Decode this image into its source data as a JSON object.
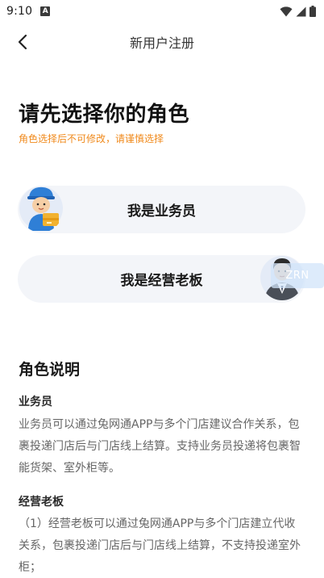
{
  "status_bar": {
    "time": "9:10",
    "notification_icon": "a-icon",
    "icons": [
      "wifi-icon",
      "signal-icon",
      "battery-icon"
    ]
  },
  "nav": {
    "back_icon": "chevron-left-icon",
    "title": "新用户注册"
  },
  "header": {
    "title": "请先选择你的角色",
    "notice": "角色选择后不可修改，请谨慎选择"
  },
  "roles": [
    {
      "label": "我是业务员",
      "avatar": "courier-avatar"
    },
    {
      "label": "我是经营老板",
      "avatar": "boss-avatar"
    }
  ],
  "watermark": "ZRN",
  "description": {
    "title": "角色说明",
    "items": [
      {
        "title": "业务员",
        "text": "业务员可以通过兔网通APP与多个门店建议合作关系，包裹投递门店后与门店线上结算。支持业务员投递将包裹智能货架、室外柜等。"
      },
      {
        "title": "经营老板",
        "text": "（1）经营老板可以通过兔网通APP与多个门店建立代收关系，包裹投递门店后与门店线上结算，不支持投递室外柜；"
      }
    ]
  },
  "colors": {
    "accent_orange": "#f08a1c",
    "card_bg": "#f3f5f9",
    "text_primary": "#1a1a1a",
    "text_secondary": "#666666"
  }
}
